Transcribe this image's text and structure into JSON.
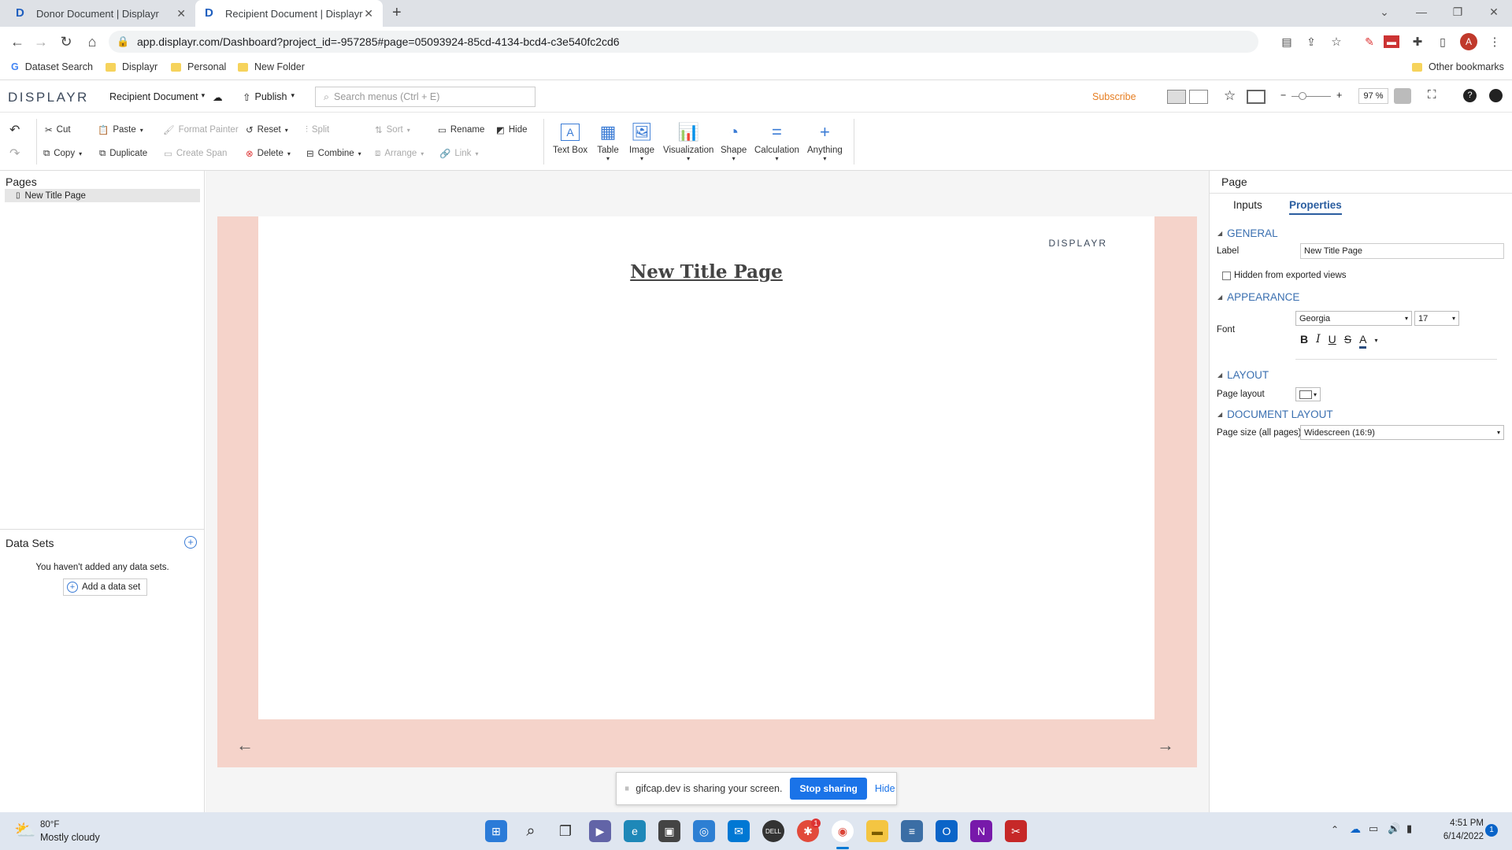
{
  "browser": {
    "tabs": [
      {
        "title": "Donor Document | Displayr"
      },
      {
        "title": "Recipient Document | Displayr"
      }
    ],
    "url": "app.displayr.com/Dashboard?project_id=-957285#page=05093924-85cd-4134-bcd4-c3e540fc2cd6",
    "bookmarks": [
      "Dataset Search",
      "Displayr",
      "Personal",
      "New Folder"
    ],
    "other_bookmarks": "Other bookmarks",
    "avatar_letter": "A"
  },
  "app": {
    "logo": "DISPLAYR",
    "document_name": "Recipient Document",
    "publish": "Publish",
    "search_placeholder": "Search menus (Ctrl + E)",
    "subscribe": "Subscribe",
    "zoom": "97 %"
  },
  "toolbar": {
    "cut": "Cut",
    "paste": "Paste",
    "format_painter": "Format Painter",
    "reset": "Reset",
    "split": "Split",
    "sort": "Sort",
    "rename": "Rename",
    "hide": "Hide",
    "copy": "Copy",
    "duplicate": "Duplicate",
    "create_span": "Create Span",
    "delete": "Delete",
    "combine": "Combine",
    "arrange": "Arrange",
    "link": "Link",
    "insert": [
      "Text Box",
      "Table",
      "Image",
      "Visualization",
      "Shape",
      "Calculation",
      "Anything"
    ]
  },
  "left_panel": {
    "pages_title": "Pages",
    "pages": [
      "New Title Page"
    ],
    "datasets_title": "Data Sets",
    "datasets_empty": "You haven't added any data sets.",
    "add_dataset": "Add a data set"
  },
  "canvas": {
    "page_title": "New Title Page",
    "logo": "DISPLAYR",
    "prev": "←",
    "next": "→"
  },
  "share_bar": {
    "message": "gifcap.dev is sharing your screen.",
    "stop": "Stop sharing",
    "hide": "Hide"
  },
  "right_panel": {
    "header": "Page",
    "tabs": [
      "Inputs",
      "Properties"
    ],
    "general": "GENERAL",
    "label_label": "Label",
    "label_value": "New Title Page",
    "hidden_label": "Hidden from exported views",
    "appearance": "APPEARANCE",
    "font_label": "Font",
    "font_family": "Georgia",
    "font_size": "17",
    "layout": "LAYOUT",
    "page_layout_label": "Page layout",
    "document_layout": "DOCUMENT LAYOUT",
    "page_size_label": "Page size (all pages)",
    "page_size_value": "Widescreen (16:9)"
  },
  "taskbar": {
    "temp": "80°F",
    "weather": "Mostly cloudy",
    "time": "4:51 PM",
    "date": "6/14/2022",
    "notification_count": "1"
  }
}
